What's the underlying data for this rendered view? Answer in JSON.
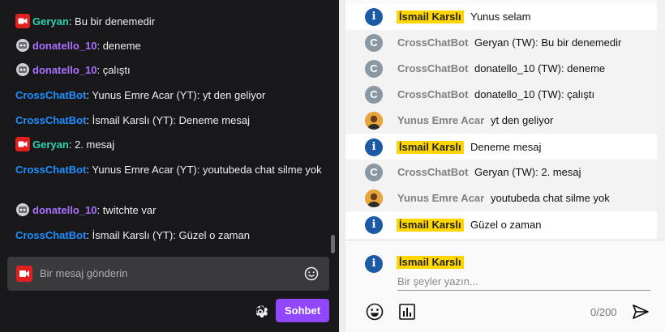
{
  "twitch": {
    "messages": [
      {
        "user": "Geryan",
        "user_class": "u-geryan",
        "badge": "video",
        "text": "Bu bir denemedir"
      },
      {
        "user": "donatello_10",
        "user_class": "u-dona",
        "badge": "bot",
        "text": "deneme"
      },
      {
        "user": "donatello_10",
        "user_class": "u-dona",
        "badge": "bot",
        "text": "çalıştı"
      },
      {
        "user": "CrossChatBot",
        "user_class": "u-bot",
        "badge": "",
        "text": "Yunus Emre Acar (YT): yt den geliyor"
      },
      {
        "user": "CrossChatBot",
        "user_class": "u-bot",
        "badge": "",
        "text": "İsmail Karslı (YT): Deneme mesaj"
      },
      {
        "user": "Geryan",
        "user_class": "u-geryan",
        "badge": "video",
        "text": "2. mesaj"
      },
      {
        "user": "CrossChatBot",
        "user_class": "u-bot",
        "badge": "",
        "text": "Yunus Emre Acar (YT): youtubeda chat silme yok"
      },
      {
        "user": "donatello_10",
        "user_class": "u-dona",
        "badge": "bot",
        "text": "twitchte var"
      },
      {
        "user": "CrossChatBot",
        "user_class": "u-bot",
        "badge": "",
        "text": "İsmail Karslı (YT): Güzel o zaman"
      }
    ],
    "input_placeholder": "Bir mesaj gönderin",
    "send_label": "Sohbet",
    "icons": {
      "settings": "gear-icon",
      "emoji": "smiley-icon",
      "badge": "video-camera-icon"
    }
  },
  "youtube": {
    "messages": [
      {
        "avatar": "i",
        "avatar_type": "i",
        "name": "İsmail Karslı",
        "owner": true,
        "text": "Yunus selam",
        "bg": "white"
      },
      {
        "avatar": "C",
        "avatar_type": "c",
        "name": "CrossChatBot",
        "owner": false,
        "text": "Geryan (TW): Bu bir denemedir",
        "bg": "grey"
      },
      {
        "avatar": "C",
        "avatar_type": "c",
        "name": "CrossChatBot",
        "owner": false,
        "text": "donatello_10 (TW): deneme",
        "bg": "grey"
      },
      {
        "avatar": "C",
        "avatar_type": "c",
        "name": "CrossChatBot",
        "owner": false,
        "text": "donatello_10 (TW): çalıştı",
        "bg": "grey"
      },
      {
        "avatar": "",
        "avatar_type": "y",
        "name": "Yunus Emre Acar",
        "owner": false,
        "text": "yt den geliyor",
        "bg": "grey"
      },
      {
        "avatar": "i",
        "avatar_type": "i",
        "name": "İsmail Karslı",
        "owner": true,
        "text": "Deneme mesaj",
        "bg": "white"
      },
      {
        "avatar": "C",
        "avatar_type": "c",
        "name": "CrossChatBot",
        "owner": false,
        "text": "Geryan (TW): 2. mesaj",
        "bg": "grey"
      },
      {
        "avatar": "",
        "avatar_type": "y",
        "name": "Yunus Emre Acar",
        "owner": false,
        "text": "youtubeda chat silme yok",
        "bg": "grey"
      },
      {
        "avatar": "i",
        "avatar_type": "i",
        "name": "İsmail Karslı",
        "owner": true,
        "text": "Güzel o zaman",
        "bg": "white"
      }
    ],
    "composer": {
      "avatar": "i",
      "name": "İsmail Karslı",
      "placeholder": "Bir şeyler yazın...",
      "counter": "0/200"
    },
    "icons": {
      "emoji": "smiley-icon",
      "superchat": "chart-icon",
      "send": "send-icon"
    },
    "colors": {
      "owner_highlight": "#ffd600",
      "avatar_owner": "#1c5aa6",
      "avatar_bot": "#8a98a3"
    }
  }
}
